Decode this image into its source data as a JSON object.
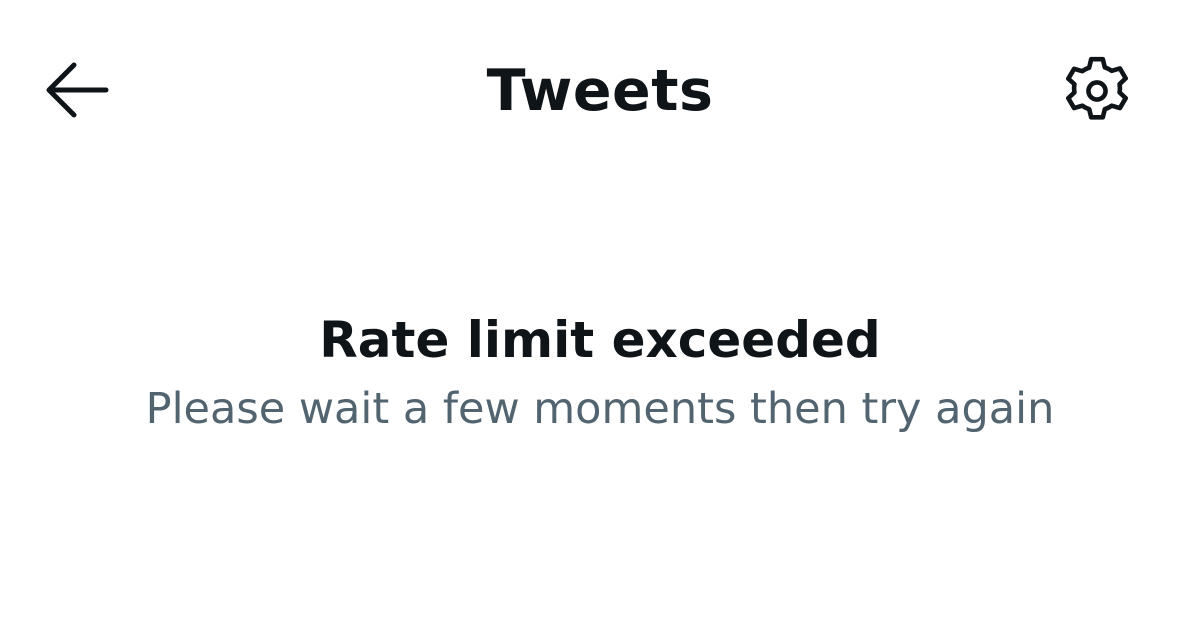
{
  "header": {
    "title": "Tweets",
    "back_icon": "arrow-left-icon",
    "settings_icon": "gear-icon"
  },
  "message": {
    "title": "Rate limit exceeded",
    "subtitle": "Please wait a few moments then try again"
  },
  "colors": {
    "background": "#ffffff",
    "primary_text": "#0f1419",
    "secondary_text": "#536471"
  }
}
